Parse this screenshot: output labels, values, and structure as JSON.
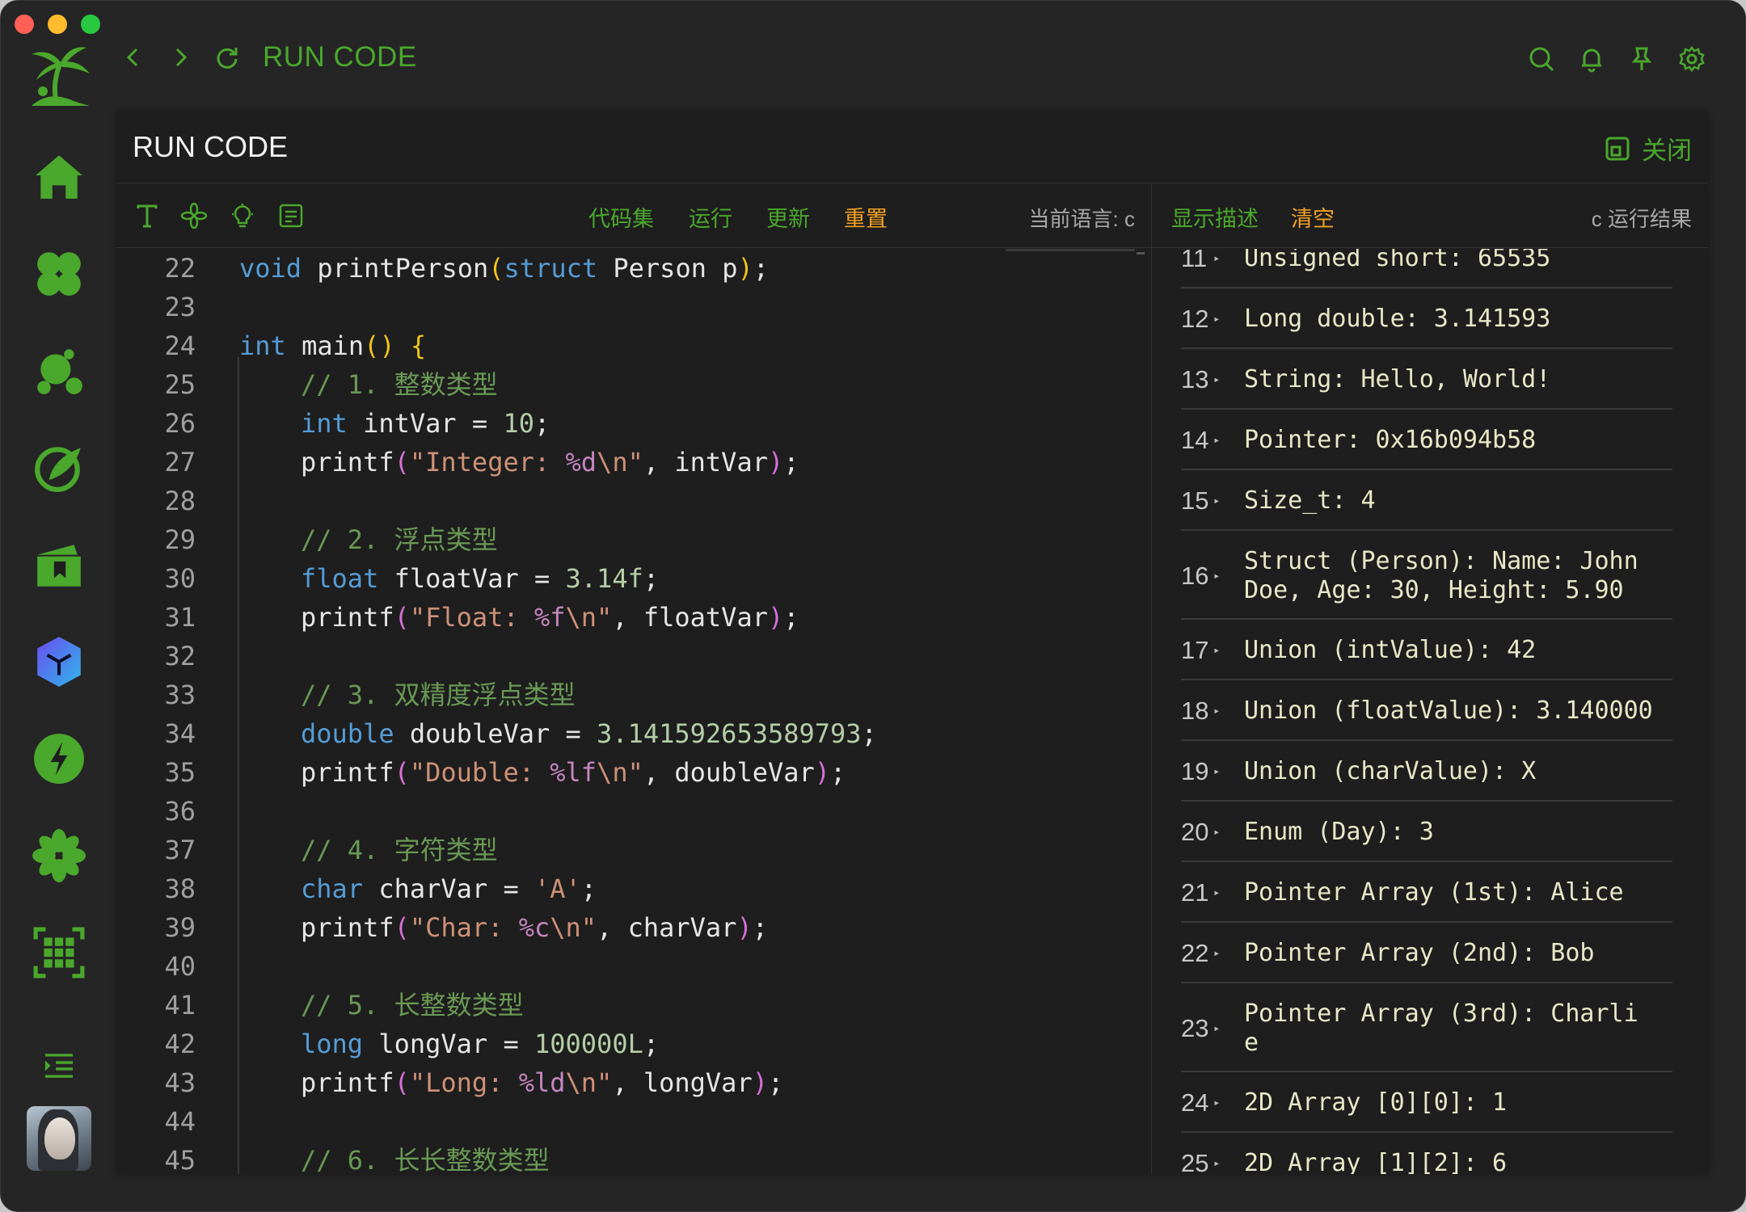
{
  "window": {
    "title": "RUN CODE"
  },
  "topbar": {
    "title": "RUN CODE"
  },
  "panel": {
    "title": "RUN CODE",
    "close_label": "关闭"
  },
  "toolbar": {
    "code_set": "代码集",
    "run": "运行",
    "update": "更新",
    "reset": "重置",
    "current_language": "当前语言: c"
  },
  "output_toolbar": {
    "show_desc": "显示描述",
    "clear": "清空",
    "result_label": "c 运行结果"
  },
  "colors": {
    "accent_green": "#4aa82c",
    "accent_orange": "#f0a024",
    "background": "#1e1e1e"
  },
  "sidebar": {
    "icons": [
      "logo-palm-icon",
      "home-icon",
      "clover-icon",
      "bubbles-icon",
      "compass-leaf-icon",
      "bookmark-box-icon",
      "cube-icon",
      "lightning-icon",
      "flower-icon",
      "grid-scan-icon",
      "indent-list-icon"
    ]
  },
  "code_lines": [
    {
      "n": "22"
    },
    {
      "n": "23"
    },
    {
      "n": "24"
    },
    {
      "n": "25"
    },
    {
      "n": "26"
    },
    {
      "n": "27"
    },
    {
      "n": "28"
    },
    {
      "n": "29"
    },
    {
      "n": "30"
    },
    {
      "n": "31"
    },
    {
      "n": "32"
    },
    {
      "n": "33"
    },
    {
      "n": "34"
    },
    {
      "n": "35"
    },
    {
      "n": "36"
    },
    {
      "n": "37"
    },
    {
      "n": "38"
    },
    {
      "n": "39"
    },
    {
      "n": "40"
    },
    {
      "n": "41"
    },
    {
      "n": "42"
    },
    {
      "n": "43"
    },
    {
      "n": "44"
    },
    {
      "n": "45"
    }
  ],
  "code": {
    "l22": [
      "void",
      " printPerson",
      "(",
      "struct",
      " Person p",
      ")",
      ";"
    ],
    "l24": [
      "int",
      " main",
      "()",
      " ",
      "{"
    ],
    "l25": "// 1. 整数类型",
    "l26": [
      "int",
      " intVar = ",
      "10",
      ";"
    ],
    "l27": [
      "printf",
      "(",
      "\"Integer: ",
      "%d",
      "\\n\"",
      ", intVar",
      ")",
      ";"
    ],
    "l29": "// 2. 浮点类型",
    "l30": [
      "float",
      " floatVar = ",
      "3.14f",
      ";"
    ],
    "l31": [
      "printf",
      "(",
      "\"Float: ",
      "%f",
      "\\n\"",
      ", floatVar",
      ")",
      ";"
    ],
    "l33": "// 3. 双精度浮点类型",
    "l34": [
      "double",
      " doubleVar = ",
      "3.141592653589793",
      ";"
    ],
    "l35": [
      "printf",
      "(",
      "\"Double: ",
      "%lf",
      "\\n\"",
      ", doubleVar",
      ")",
      ";"
    ],
    "l37": "// 4. 字符类型",
    "l38": [
      "char",
      " charVar = ",
      "'A'",
      ";"
    ],
    "l39": [
      "printf",
      "(",
      "\"Char: ",
      "%c",
      "\\n\"",
      ", charVar",
      ")",
      ";"
    ],
    "l41": "// 5. 长整数类型",
    "l42": [
      "long",
      " longVar = ",
      "100000L",
      ";"
    ],
    "l43": [
      "printf",
      "(",
      "\"Long: ",
      "%ld",
      "\\n\"",
      ", longVar",
      ")",
      ";"
    ],
    "l45": "// 6. 长长整数类型"
  },
  "output": [
    {
      "n": "11",
      "text": "Unsigned short: 65535"
    },
    {
      "n": "12",
      "text": "Long double: 3.141593"
    },
    {
      "n": "13",
      "text": "String: Hello, World!"
    },
    {
      "n": "14",
      "text": "Pointer: 0x16b094b58"
    },
    {
      "n": "15",
      "text": "Size_t: 4"
    },
    {
      "n": "16",
      "text": "Struct (Person): Name: John\nDoe, Age: 30, Height: 5.90"
    },
    {
      "n": "17",
      "text": "Union (intValue): 42"
    },
    {
      "n": "18",
      "text": "Union (floatValue): 3.140000"
    },
    {
      "n": "19",
      "text": "Union (charValue): X"
    },
    {
      "n": "20",
      "text": "Enum (Day): 3"
    },
    {
      "n": "21",
      "text": "Pointer Array (1st): Alice"
    },
    {
      "n": "22",
      "text": "Pointer Array (2nd): Bob"
    },
    {
      "n": "23",
      "text": "Pointer Array (3rd): Charli\ne"
    },
    {
      "n": "24",
      "text": "2D Array [0][0]: 1"
    },
    {
      "n": "25",
      "text": "2D Array [1][2]: 6"
    }
  ]
}
